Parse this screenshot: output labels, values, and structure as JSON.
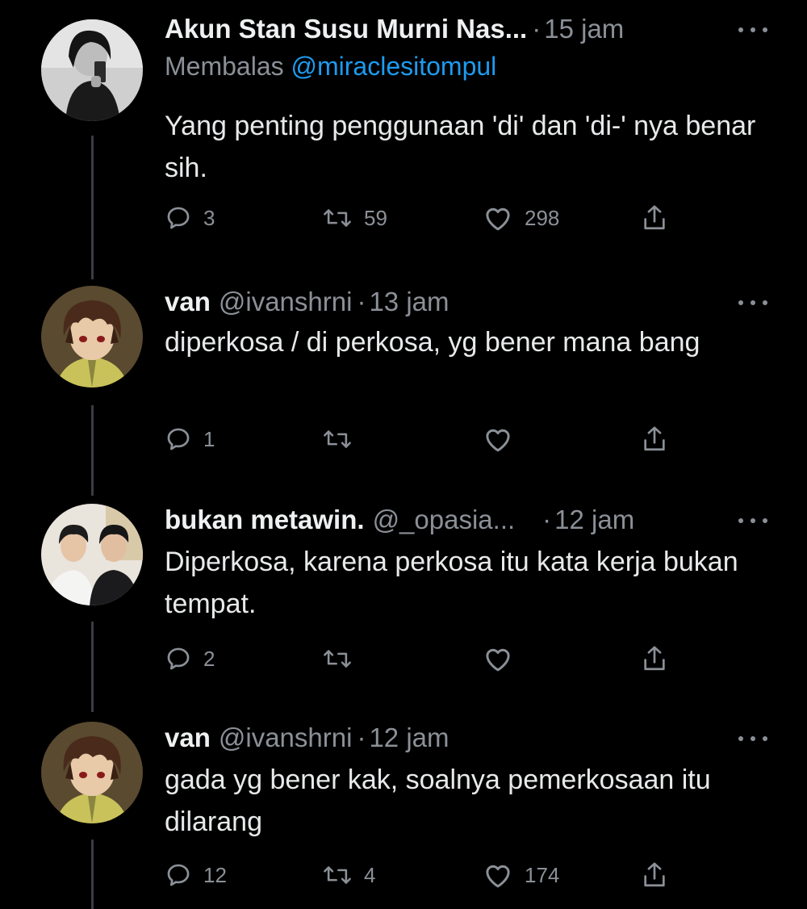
{
  "colors": {
    "background": "#000000",
    "text": "#e7e9ea",
    "muted": "#8b9097",
    "link": "#1d9bf0",
    "thread_line": "#3a3d41"
  },
  "tweets": [
    {
      "display_name": "Akun Stan Susu Murni Nas...",
      "handle": "",
      "time": "15 jam",
      "reply_label": "Membalas",
      "reply_mention": "@miraclesitompul",
      "text": "Yang penting penggunaan 'di' dan 'di-' nya benar sih.",
      "replies": "3",
      "retweets": "59",
      "likes": "298",
      "avatar_icon": "selfie-avatar"
    },
    {
      "display_name": "van",
      "handle": "@ivanshrni",
      "time": "13 jam",
      "text": "diperkosa / di perkosa, yg bener mana bang",
      "replies": "1",
      "retweets": "",
      "likes": "",
      "avatar_icon": "anime-avatar"
    },
    {
      "display_name": "bukan metawin.",
      "handle": "@_opasia...",
      "time": "12 jam",
      "text": "Diperkosa, karena perkosa itu kata kerja bukan tempat.",
      "replies": "2",
      "retweets": "",
      "likes": "",
      "avatar_icon": "two-people-avatar"
    },
    {
      "display_name": "van",
      "handle": "@ivanshrni",
      "time": "12 jam",
      "text": "gada yg bener kak, soalnya pemerkosaan itu dilarang",
      "replies": "12",
      "retweets": "4",
      "likes": "174",
      "avatar_icon": "anime-avatar"
    }
  ],
  "separator": "·"
}
